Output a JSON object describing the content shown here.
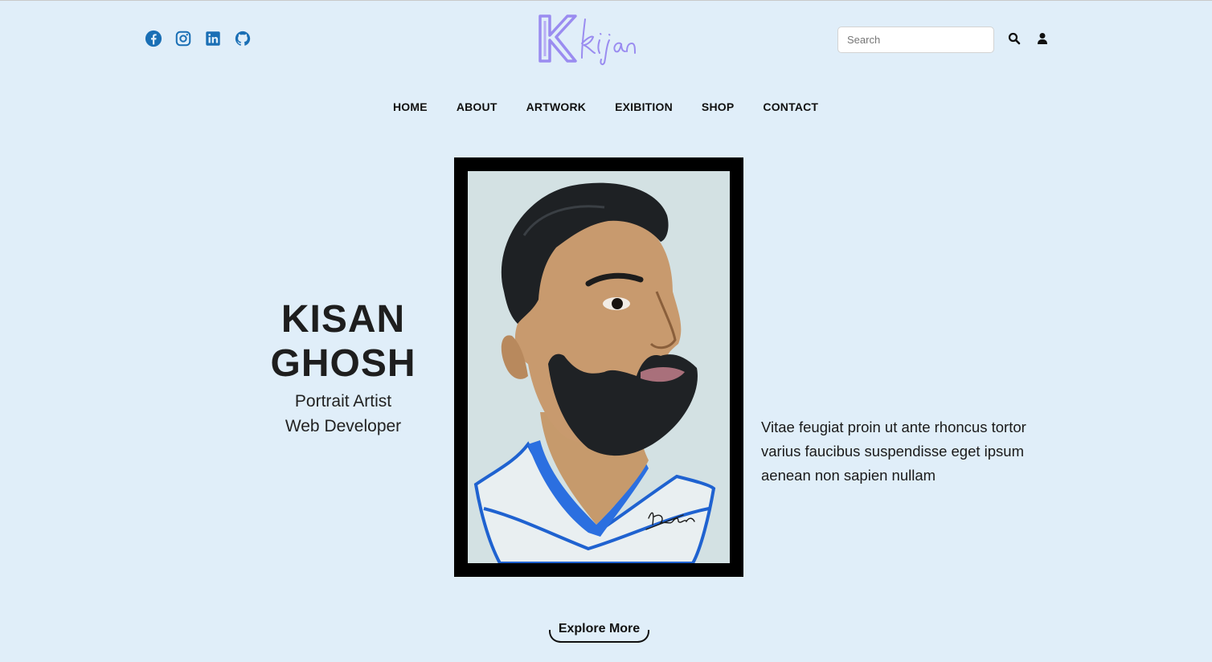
{
  "brand": {
    "logo_text": "Kisan",
    "logo_color": "#9a8cf0"
  },
  "social": [
    {
      "name": "facebook-icon"
    },
    {
      "name": "instagram-icon"
    },
    {
      "name": "linkedin-icon"
    },
    {
      "name": "github-icon"
    }
  ],
  "social_color": "#1a6fb5",
  "search": {
    "placeholder": "Search",
    "value": ""
  },
  "nav": {
    "items": [
      "HOME",
      "ABOUT",
      "ARTWORK",
      "EXIBITION",
      "SHOP",
      "CONTACT"
    ]
  },
  "hero": {
    "name_line1": "KISAN",
    "name_line2": "GHOSH",
    "role1": "Portrait Artist",
    "role2": "Web Developer",
    "description": "Vitae feugiat proin ut ante rhoncus tortor varius faucibus suspendisse eget ipsum aenean non sapien nullam",
    "signature": "Kisan",
    "cta": "Explore More"
  },
  "colors": {
    "background": "#e0eef9",
    "text": "#1c1c1c",
    "frame": "#000000"
  }
}
